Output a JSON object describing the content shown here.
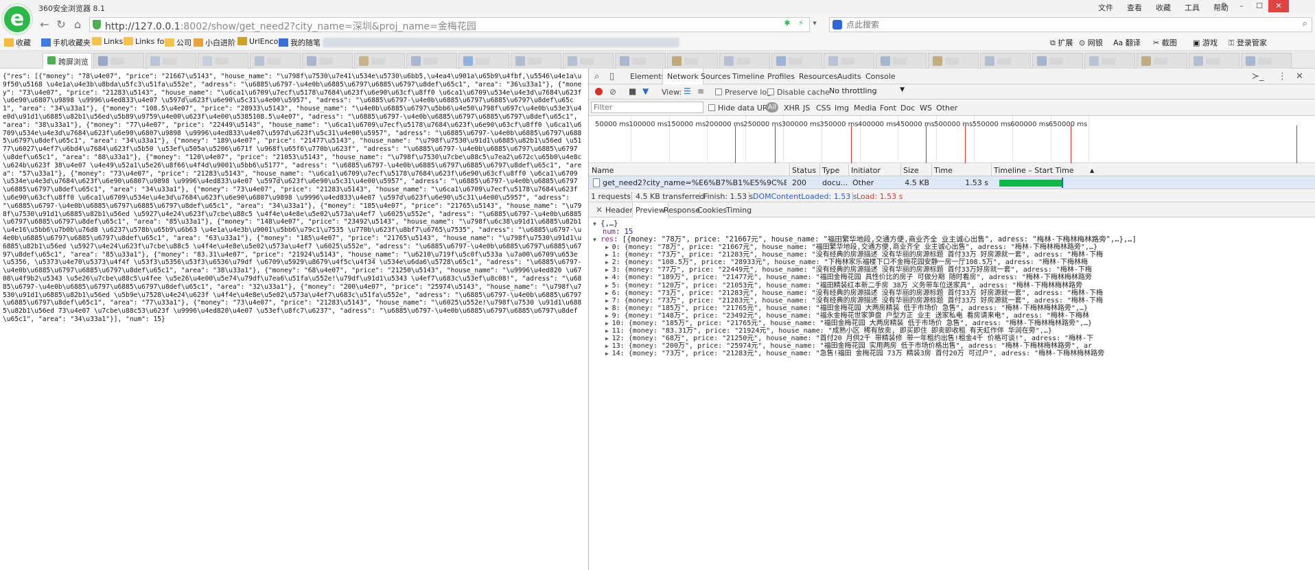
{
  "window": {
    "app_title": "360安全浏览器 8.1",
    "menu": [
      "文件",
      "查看",
      "收藏",
      "工具",
      "帮助"
    ],
    "controls": [
      "⚲",
      "–",
      "☐",
      "✕"
    ]
  },
  "address_bar": {
    "url_host": "http://127.0.0.1",
    "url_rest": ":8002/show/get_need2?city_name=深圳&proj_name=金梅花园",
    "search_placeholder": "点此搜索"
  },
  "bookmarks": {
    "items": [
      "收藏",
      "手机收藏夹",
      "Links",
      "Links fo",
      "公司",
      "小白进阶",
      "UrlEnco",
      "我的随笔"
    ],
    "right": [
      "扩展",
      "网银",
      "翻译",
      "截图",
      "游戏",
      "登录管家"
    ]
  },
  "tabs": {
    "first": "跨屏浏览"
  },
  "page_text": "{\"res\": [{\"money\": \"78\\u4e07\", \"price\": \"21667\\u5143\", \"house_name\": \"\\u798f\\u7530\\u7e41\\u534e\\u5730\\u6bb5,\\u4ea4\\u901a\\u65b9\\u4fbf,\\u5546\\u4e1a\\u9f50\\u5168 \\u4e1a\\u4e3b\\u8bda\\u5fc3\\u51fa\\u552e\", \"adress\": \"\\u6885\\u6797-\\u4e0b\\u6885\\u6797\\u6885\\u6797\\u8def\\u65c1\", \"area\": \"36\\u33a1\"}, {\"money\": \"73\\u4e07\", \"price\": \"21283\\u5143\", \"house_name\": \"\\u6ca1\\u6709\\u7ecf\\u5178\\u7684\\u623f\\u6e90\\u63cf\\u8ff0 \\u6ca1\\u6709\\u534e\\u4e3d\\u7684\\u623f\\u6e90\\u6807\\u9898 \\u9996\\u4ed833\\u4e07 \\u597d\\u623f\\u6e90\\u5c31\\u4e00\\u5957\", \"adress\": \"\\u6885\\u6797-\\u4e0b\\u6885\\u6797\\u6885\\u6797\\u8def\\u65c1\", \"area\": \"34\\u33a1\"}, {\"money\": \"108.5\\u4e07\", \"price\": \"28933\\u5143\", \"house_name\": \"\\u4e0b\\u6885\\u6797\\u5bb6\\u4e50\\u798f\\u697c\\u4e0b\\u53e3\\u4e0d\\u91d1\\u6885\\u82b1\\u56ed\\u5b89\\u9759\\u4e00\\u623f\\u4e00\\u5385108.5\\u4e07\", \"adress\": \"\\u6885\\u6797-\\u4e0b\\u6885\\u6797\\u6885\\u6797\\u8def\\u65c1\", \"area\": \"38\\u33a1\"}, {\"money\": \"77\\u4e07\", \"price\": \"22449\\u5143\", \"house_name\": \"\\u6ca1\\u6709\\u7ecf\\u5178\\u7684\\u623f\\u6e90\\u63cf\\u8ff0 \\u6ca1\\u6709\\u534e\\u4e3d\\u7684\\u623f\\u6e90\\u6807\\u9898 \\u9996\\u4ed833\\u4e07\\u597d\\u623f\\u5c31\\u4e00\\u5957\", \"adress\": \"\\u6885\\u6797-\\u4e0b\\u6885\\u6797\\u6885\\u6797\\u8def\\u65c1\", \"area\": \"34\\u33a1\"}, {\"money\": \"189\\u4e07\", \"price\": \"21477\\u5143\", \"house_name\": \"\\u798f\\u7530\\u91d1\\u6885\\u82b1\\u56ed \\u5177\\u6027\\u4ef7\\u6bd4\\u7684\\u623f\\u5b50 \\u53ef\\u505a\\u5206\\u671f \\u968f\\u65f6\\u770b\\u623f\", \"adress\": \"\\u6885\\u6797-\\u4e0b\\u6885\\u6797\\u6885\\u6797\\u8def\\u65c1\", \"area\": \"88\\u33a1\"}, {\"money\": \"120\\u4e07\", \"price\": \"21053\\u5143\", \"house_name\": \"\\u798f\\u7530\\u7cbe\\u88c5\\u7ea2\\u672c\\u65b0\\u4e8c\\u624b\\u623f 38\\u4e07 \\u4e49\\u52a1\\u5e26\\u8f66\\u4f4d\\u9001\\u5bb6\\u5177\", \"adress\": \"\\u6885\\u6797-\\u4e0b\\u6885\\u6797\\u6885\\u6797\\u8def\\u65c1\", \"area\": \"57\\u33a1\"}, {\"money\": \"73\\u4e07\", \"price\": \"21283\\u5143\", \"house_name\": \"\\u6ca1\\u6709\\u7ecf\\u5178\\u7684\\u623f\\u6e90\\u63cf\\u8ff0 \\u6ca1\\u6709\\u534e\\u4e3d\\u7684\\u623f\\u6e90\\u6807\\u9898 \\u9996\\u4ed833\\u4e07 \\u597d\\u623f\\u6e90\\u5c31\\u4e00\\u5957\", \"adress\": \"\\u6885\\u6797-\\u4e0b\\u6885\\u6797\\u6885\\u6797\\u8def\\u65c1\", \"area\": \"34\\u33a1\"}, {\"money\": \"73\\u4e07\", \"price\": \"21283\\u5143\", \"house_name\": \"\\u6ca1\\u6709\\u7ecf\\u5178\\u7684\\u623f\\u6e90\\u63cf\\u8ff0 \\u6ca1\\u6709\\u534e\\u4e3d\\u7684\\u623f\\u6e90\\u6807\\u9898 \\u9996\\u4ed833\\u4e07 \\u597d\\u623f\\u6e90\\u5c31\\u4e00\\u5957\", \"adress\": \"\\u6885\\u6797-\\u4e0b\\u6885\\u6797\\u6885\\u6797\\u8def\\u65c1\", \"area\": \"34\\u33a1\"}, {\"money\": \"185\\u4e07\", \"price\": \"21765\\u5143\", \"house_name\": \"\\u798f\\u7530\\u91d1\\u6885\\u82b1\\u56ed \\u5927\\u4e24\\u623f\\u7cbe\\u88c5 \\u4f4e\\u4e8e\\u5e02\\u573a\\u4ef7 \\u6025\\u552e\", \"adress\": \"\\u6885\\u6797-\\u4e0b\\u6885\\u6797\\u6885\\u6797\\u8def\\u65c1\", \"area\": \"85\\u33a1\"}, {\"money\": \"148\\u4e07\", \"price\": \"23492\\u5143\", \"house_name\": \"\\u798f\\u6c38\\u91d1\\u6885\\u82b1\\u4e16\\u5bb6\\u7b0b\\u76d8 \\u6237\\u578b\\u65b9\\u6b63 \\u4e1a\\u4e3b\\u9001\\u5bb6\\u79c1\\u7535 \\u770b\\u623f\\u8bf7\\u6765\\u7535\", \"adress\": \"\\u6885\\u6797-\\u4e0b\\u6885\\u6797\\u6885\\u6797\\u8def\\u65c1\", \"area\": \"63\\u33a1\"}, {\"money\": \"185\\u4e07\", \"price\": \"21765\\u5143\", \"house_name\": \"\\u798f\\u7530\\u91d1\\u6885\\u82b1\\u56ed \\u5927\\u4e24\\u623f\\u7cbe\\u88c5 \\u4f4e\\u4e8e\\u5e02\\u573a\\u4ef7 \\u6025\\u552e\", \"adress\": \"\\u6885\\u6797-\\u4e0b\\u6885\\u6797\\u6885\\u6797\\u8def\\u65c1\", \"area\": \"85\\u33a1\"}, {\"money\": \"83.31\\u4e07\", \"price\": \"21924\\u5143\", \"house_name\": \"\\u6210\\u719f\\u5c0f\\u533a \\u7a00\\u6709\\u653e\\u5356, \\u5373\\u4e70\\u5373\\u4f4f \\u53f3\\u5356\\u53f3\\u6536\\u79df \\u6709\\u5929\\u8679\\u4f5c\\u4f34 \\u534e\\u6da6\\u5728\\u65c1\", \"adress\": \"\\u6885\\u6797-\\u4e0b\\u6885\\u6797\\u6885\\u6797\\u8def\\u65c1\", \"area\": \"38\\u33a1\"}, {\"money\": \"68\\u4e07\", \"price\": \"21250\\u5143\", \"house_name\": \"\\u9996\\u4ed820 \\u6708\\u4f9b2\\u5343 \\u5e26\\u7cbe\\u88c5\\u4fee \\u5e26\\u4e00\\u5e74\\u79df\\u7ea6\\u51fa\\u552e!\\u79df\\u91d1\\u5343 \\u4ef7\\u683c\\u53ef\\u8c08!\", \"adress\": \"\\u6885\\u6797-\\u4e0b\\u6885\\u6797\\u6885\\u6797\\u8def\\u65c1\", \"area\": \"32\\u33a1\"}, {\"money\": \"200\\u4e07\", \"price\": \"25974\\u5143\", \"house_name\": \"\\u798f\\u7530\\u91d1\\u6885\\u82b1\\u56ed \\u5b9e\\u7528\\u4e24\\u623f \\u4f4e\\u4e8e\\u5e02\\u573a\\u4ef7\\u683c\\u51fa\\u552e\", \"adress\": \"\\u6885\\u6797-\\u4e0b\\u6885\\u6797\\u6885\\u6797\\u8def\\u65c1\", \"area\": \"77\\u33a1\"}, {\"money\": \"73\\u4e07\", \"price\": \"21283\\u5143\", \"house_name\": \"\\u6025\\u552e!\\u798f\\u7530 \\u91d1\\u6885\\u82b1\\u56ed 73\\u4e07 \\u7cbe\\u88c53\\u623f \\u9996\\u4ed820\\u4e07 \\u53ef\\u8fc7\\u6237\", \"adress\": \"\\u6885\\u6797-\\u4e0b\\u6885\\u6797\\u6885\\u6797\\u8def\\u65c1\", \"area\": \"34\\u33a1\"}], \"num\": 15}",
  "devtools": {
    "tabs": [
      "Elements",
      "Network",
      "Sources",
      "Timeline",
      "Profiles",
      "Resources",
      "Audits",
      "Console"
    ],
    "active_tab": "Network",
    "toolbar": {
      "view_label": "View:",
      "preserve_log": "Preserve log",
      "disable_cache": "Disable cache",
      "throttling": "No throttling"
    },
    "filter": {
      "placeholder": "Filter",
      "hide_data_urls": "Hide data URLs",
      "types": [
        "All",
        "XHR",
        "JS",
        "CSS",
        "Img",
        "Media",
        "Font",
        "Doc",
        "WS",
        "Other"
      ]
    },
    "timeline_ticks": [
      "50000 ms",
      "100000 ms",
      "150000 ms",
      "200000 ms",
      "250000 ms",
      "300000 ms",
      "350000 ms",
      "400000 ms",
      "450000 ms",
      "500000 ms",
      "550000 ms",
      "600000 ms",
      "650000 ms"
    ],
    "columns": [
      "Name",
      "Status",
      "Type",
      "Initiator",
      "Size",
      "Time",
      "Timeline – Start Time"
    ],
    "request": {
      "name": "get_need2?city_name=%E6%B7%B1%E5%9C%B3&proj_nam...",
      "status": "200",
      "type": "docu...",
      "initiator": "Other",
      "size": "4.5 KB",
      "time": "1.53 s"
    },
    "summary": {
      "requests": "1 requests",
      "transferred": "4.5 KB transferred",
      "finish": "Finish: 1.53 s",
      "dom_loaded": "DOMContentLoaded: 1.53 s",
      "load": "Load: 1.53 s"
    },
    "detail_tabs": [
      "Headers",
      "Preview",
      "Response",
      "Cookies",
      "Timing"
    ],
    "active_detail_tab": "Preview",
    "preview": {
      "root": "{,…}",
      "num_key": "num",
      "num_value": "15",
      "res_key": "res",
      "res_summary": "[{money: \"78万\", price: \"21667元\", house_name: \"福田繁华地段,交通方便,商业齐全 业主诚心出售\", adress: \"梅林-下梅林梅林路旁\",…},…]",
      "items": [
        "0: {money: \"78万\", price: \"21667元\", house_name: \"福田繁华地段,交通方便,商业齐全 业主诚心出售\", adress: \"梅林-下梅林梅林路旁\",…}",
        "1: {money: \"73万\", price: \"21283元\", house_name: \"没有经典的房源描述 没有华丽的房源标题 首付33万 好房源就一套\", adress: \"梅林-下梅",
        "2: {money: \"108.5万\", price: \"28933元\", house_name: \"下梅林家乐福楼下口不金梅花园安静一房一厅108.5万\", adress: \"梅林-下梅林梅",
        "3: {money: \"77万\", price: \"22449元\", house_name: \"没有经典的房源描述 没有华丽的房源标题 首付33万好房就一套\", adress: \"梅林-下梅",
        "4: {money: \"189万\", price: \"21477元\", house_name: \"福田金梅花园 具性价比的房子 可做分期 随时看房\", adress: \"梅林-下梅林梅林路旁",
        "5: {money: \"120万\", price: \"21053元\", house_name: \"福田精装红本新二手房 38万 义务带车位送家具\", adress: \"梅林-下梅林梅林路旁",
        "6: {money: \"73万\", price: \"21283元\", house_name: \"没有经典的房源描述 没有华丽的房源标题 首付33万 好房源就一套\", adress: \"梅林-下梅",
        "7: {money: \"73万\", price: \"21283元\", house_name: \"没有经典的房源描述 没有华丽的房源标题 首付33万 好房源就一套\", adress: \"梅林-下梅",
        "8: {money: \"185万\", price: \"21765元\", house_name: \"福田金梅花园 大两房精装 低于市场价 急售\", adress: \"梅林-下梅林梅林路旁\",…}",
        "9: {money: \"148万\", price: \"23492元\", house_name: \"福永金梅花世家笋盘 户型方正 业主 送家私电 看房请来电\", adress: \"梅林-下梅林",
        "10: {money: \"185万\", price: \"21765元\", house_name: \"福田金梅花园 大两房精装 低于市场价 急售\", adress: \"梅林-下梅林梅林路旁\",…}",
        "11: {money: \"83.31万\", price: \"21924元\", house_name: \"成熟小区 稀有放卖, 即买即住 即卖即收租 有天虹作伴 华润在旁\",…}",
        "12: {money: \"68万\", price: \"21250元\", house_name: \"首付20 月供2千 带精装修 带一年租约出售!租金4千 价格可谈!\", adress: \"梅林-下",
        "13: {money: \"200万\", price: \"25974元\", house_name: \"福田金梅花园 实用两房 低于市场价格出售\", adress: \"梅林-下梅林梅林路旁\", ar",
        "14: {money: \"73万\", price: \"21283元\", house_name: \"急售!福田 金梅花园 73万 精装3房 首付20万 可过户\", adress: \"梅林-下梅林梅林路旁"
      ]
    }
  },
  "colors": {
    "brand_green": "#2db84a",
    "record_red": "#d93025",
    "waterfall_green": "#10b646",
    "dom_blue": "#2a5bd7",
    "load_red": "#d03a2f",
    "selected_row": "#dfe9f6"
  }
}
